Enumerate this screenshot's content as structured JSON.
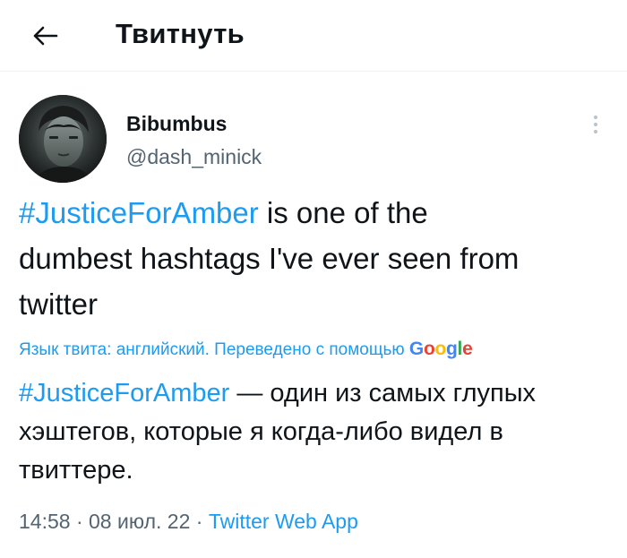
{
  "header": {
    "title": "Твитнуть"
  },
  "author": {
    "name": "Bibumbus",
    "handle": "@dash_minick"
  },
  "tweet": {
    "hashtag": "#JusticeForAmber",
    "text_line1_rest": " is one of the",
    "text_line2": "dumbest hashtags I've ever seen from",
    "text_line3": "twitter"
  },
  "translation": {
    "note": "Язык твита: английский. Переведено с помощью",
    "provider": "Google",
    "hashtag": "#JusticeForAmber",
    "text_rest": " — один из самых глупых хэштегов, которые я когда-либо видел в твиттере."
  },
  "meta": {
    "time": "14:58",
    "separator": " · ",
    "date": "08 июл. 22",
    "app": "Twitter Web App"
  },
  "colors": {
    "accent": "#1d9bf0",
    "secondary_text": "#536471",
    "primary_text": "#0f1419",
    "google_blue": "#4285f4",
    "google_red": "#ea4335",
    "google_yellow": "#fbbc05",
    "google_green": "#34a853"
  },
  "icons": {
    "back": "arrow-left-icon",
    "more": "more-vertical-icon"
  }
}
